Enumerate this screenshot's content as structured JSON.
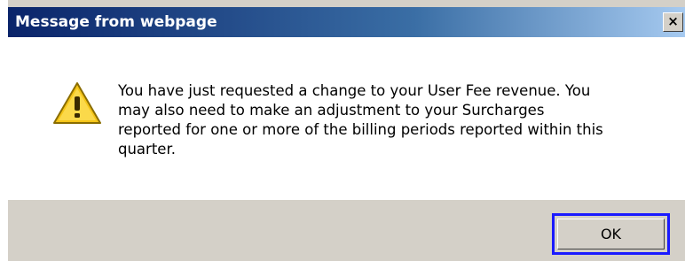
{
  "dialog": {
    "title": "Message from webpage",
    "close_label": "×",
    "icon": "warning-icon",
    "message": "You have just requested a change to your User Fee revenue. You\nmay also need to make an adjustment to your Surcharges\nreported for one or more of the billing periods reported within this\nquarter.",
    "ok_label": "OK"
  },
  "colors": {
    "titlebar_start": "#0a246a",
    "titlebar_end": "#a6caf0",
    "dialog_face": "#d4d0c8",
    "focus_outline": "#1a1aff",
    "warning_yellow": "#f5c518"
  }
}
